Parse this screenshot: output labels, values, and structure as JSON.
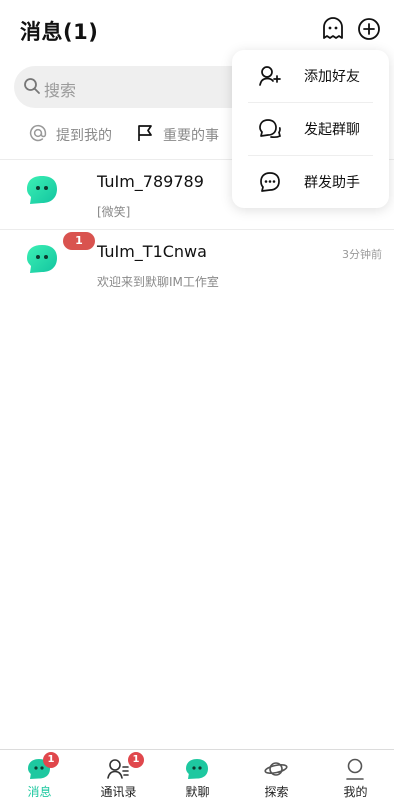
{
  "header": {
    "title": "消息(1)",
    "icons": [
      "ghost-icon",
      "plus-circle-icon"
    ]
  },
  "search": {
    "placeholder": "搜索"
  },
  "quick_links": [
    {
      "label": "提到我的",
      "icon": "at-icon"
    },
    {
      "label": "重要的事",
      "icon": "flag-icon"
    }
  ],
  "conversations": [
    {
      "name": "TuIm_789789",
      "preview": "[微笑]",
      "time": "",
      "unread": ""
    },
    {
      "name": "TuIm_T1Cnwa",
      "preview": "欢迎来到默聊IM工作室",
      "time": "3分钟前",
      "unread": "1"
    }
  ],
  "menu": {
    "items": [
      {
        "label": "添加好友",
        "icon": "add-friend-icon"
      },
      {
        "label": "发起群聊",
        "icon": "chat-bubbles-icon"
      },
      {
        "label": "群发助手",
        "icon": "broadcast-chat-icon"
      }
    ]
  },
  "tabbar": {
    "tabs": [
      {
        "label": "消息",
        "badge": "1",
        "active": true
      },
      {
        "label": "通讯录",
        "badge": "1",
        "active": false
      },
      {
        "label": "默聊",
        "badge": "",
        "active": false
      },
      {
        "label": "探索",
        "badge": "",
        "active": false
      },
      {
        "label": "我的",
        "badge": "",
        "active": false
      }
    ]
  },
  "colors": {
    "accent": "#1ec8a0",
    "badge": "#e0474c",
    "unread_pill": "#d9534f"
  }
}
